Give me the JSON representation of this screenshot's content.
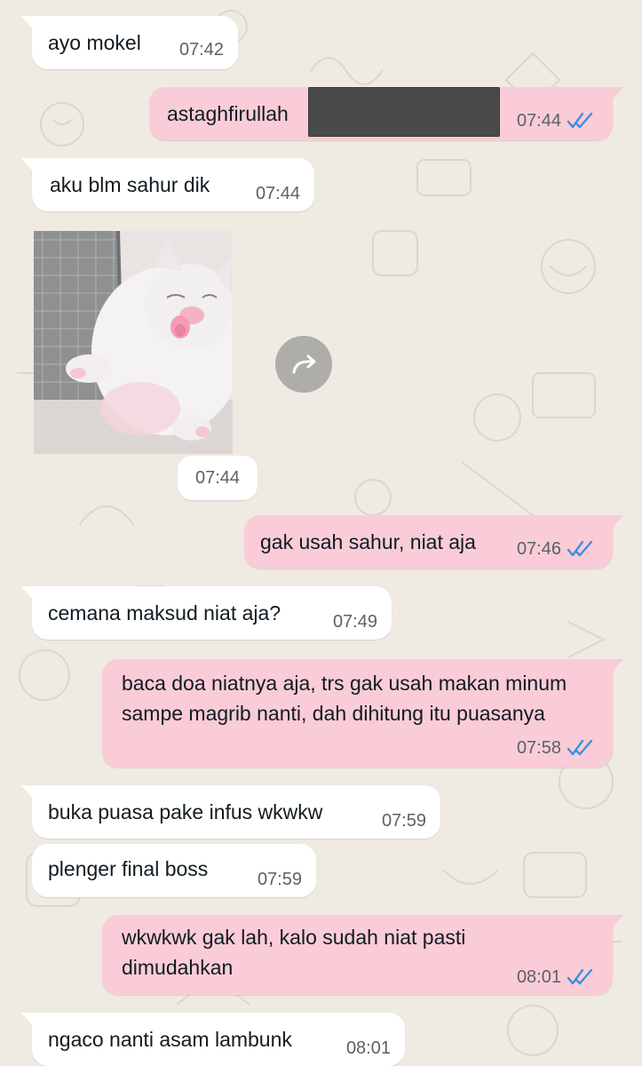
{
  "messages": [
    {
      "text": "ayo mokel",
      "time": "07:42"
    },
    {
      "text": "astaghfirullah",
      "time": "07:44"
    },
    {
      "text": "aku blm sahur dik",
      "time": "07:44"
    },
    {
      "text": "",
      "time": "07:44"
    },
    {
      "text": "gak usah sahur, niat aja",
      "time": "07:46"
    },
    {
      "text": "cemana maksud niat aja?",
      "time": "07:49"
    },
    {
      "text": "baca doa niatnya aja, trs gak usah makan minum sampe magrib nanti, dah dihitung itu puasanya",
      "time": "07:58"
    },
    {
      "text": "buka puasa pake infus wkwkw",
      "time": "07:59"
    },
    {
      "text": "plenger final boss",
      "time": "07:59"
    },
    {
      "text": "wkwkwk gak lah, kalo sudah niat pasti dimudahkan",
      "time": "08:01"
    },
    {
      "text": "ngaco nanti asam lambunk",
      "time": "08:01"
    }
  ],
  "icons": {
    "read_receipt": "double-check-icon",
    "forward": "forward-icon"
  },
  "colors": {
    "background": "#efeae2",
    "incoming_bubble": "#ffffff",
    "outgoing_bubble": "#f9ccd8",
    "read_ticks": "#3d8fe0",
    "timestamp": "#5c6166"
  }
}
